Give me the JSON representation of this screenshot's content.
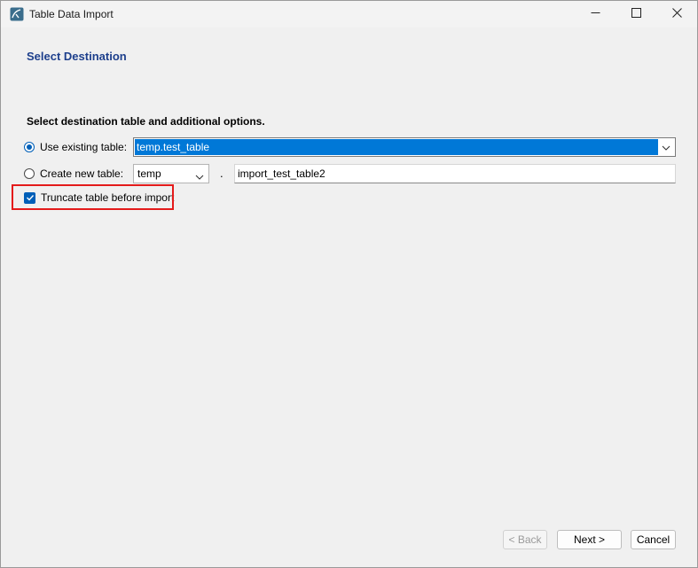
{
  "window": {
    "title": "Table Data Import"
  },
  "page": {
    "heading": "Select Destination",
    "instructions": "Select destination table and additional options."
  },
  "options": {
    "use_existing_label": "Use existing table:",
    "use_existing_selected": true,
    "existing_table_value": "temp.test_table",
    "create_new_label": "Create new table:",
    "create_new_selected": false,
    "schema_value": "temp",
    "separator": ".",
    "new_table_value": "import_test_table2",
    "truncate_label": "Truncate table before import",
    "truncate_checked": true
  },
  "buttons": {
    "back_label": "< Back",
    "next_label": "Next >",
    "cancel_label": "Cancel"
  },
  "colors": {
    "heading": "#1d3f8c",
    "accent": "#005fb8",
    "selection": "#0078d7",
    "highlight_box": "#e41b1b"
  },
  "icons": {
    "app": "mysql-workbench-icon",
    "minimize": "minimize-icon",
    "maximize": "maximize-icon",
    "close": "close-icon",
    "dropdown": "chevron-down-icon",
    "checkbox": "checkmark-icon"
  }
}
